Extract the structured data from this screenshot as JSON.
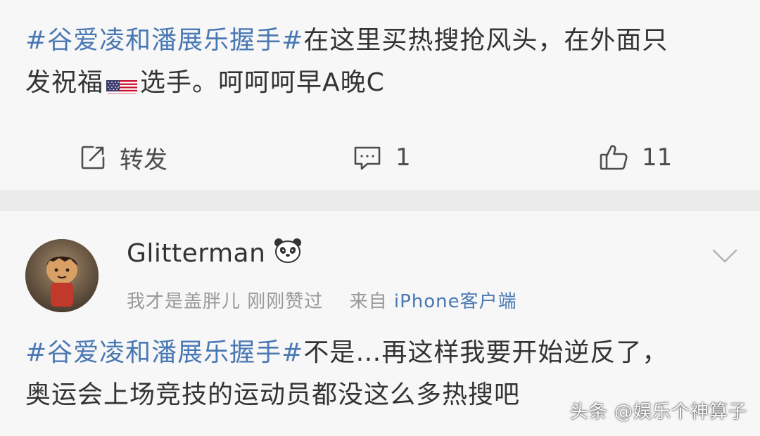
{
  "post": {
    "hashtag": "#谷爱凌和潘展乐握手#",
    "text_line1": "在这里买热搜抢风头，在外面只",
    "text_line2_a": "发祝福",
    "flag_icon": "us-flag-icon",
    "text_line2_b": "选手。呵呵呵早A晚C"
  },
  "actions": {
    "repost_label": "转发",
    "comment_count": "1",
    "like_count": "11",
    "icon_color": "#4d4d4d"
  },
  "comment": {
    "username": "Glitterman",
    "badge_icon": "panda-icon",
    "meta_name": "我才是盖胖儿",
    "meta_liked": "刚刚赞过",
    "source_prefix": "来自",
    "source": "iPhone客户端",
    "hashtag": "#谷爱凌和潘展乐握手#",
    "text_line1": "不是…再这样我要开始逆反了，",
    "text_line2": "奥运会上场竞技的运动员都没这么多热搜吧"
  },
  "watermark": "头条 @娱乐个神算子",
  "colors": {
    "link": "#4a78b3",
    "text": "#333333",
    "meta": "#999999",
    "background": "#f7f7f7",
    "divider": "#ebebeb"
  }
}
